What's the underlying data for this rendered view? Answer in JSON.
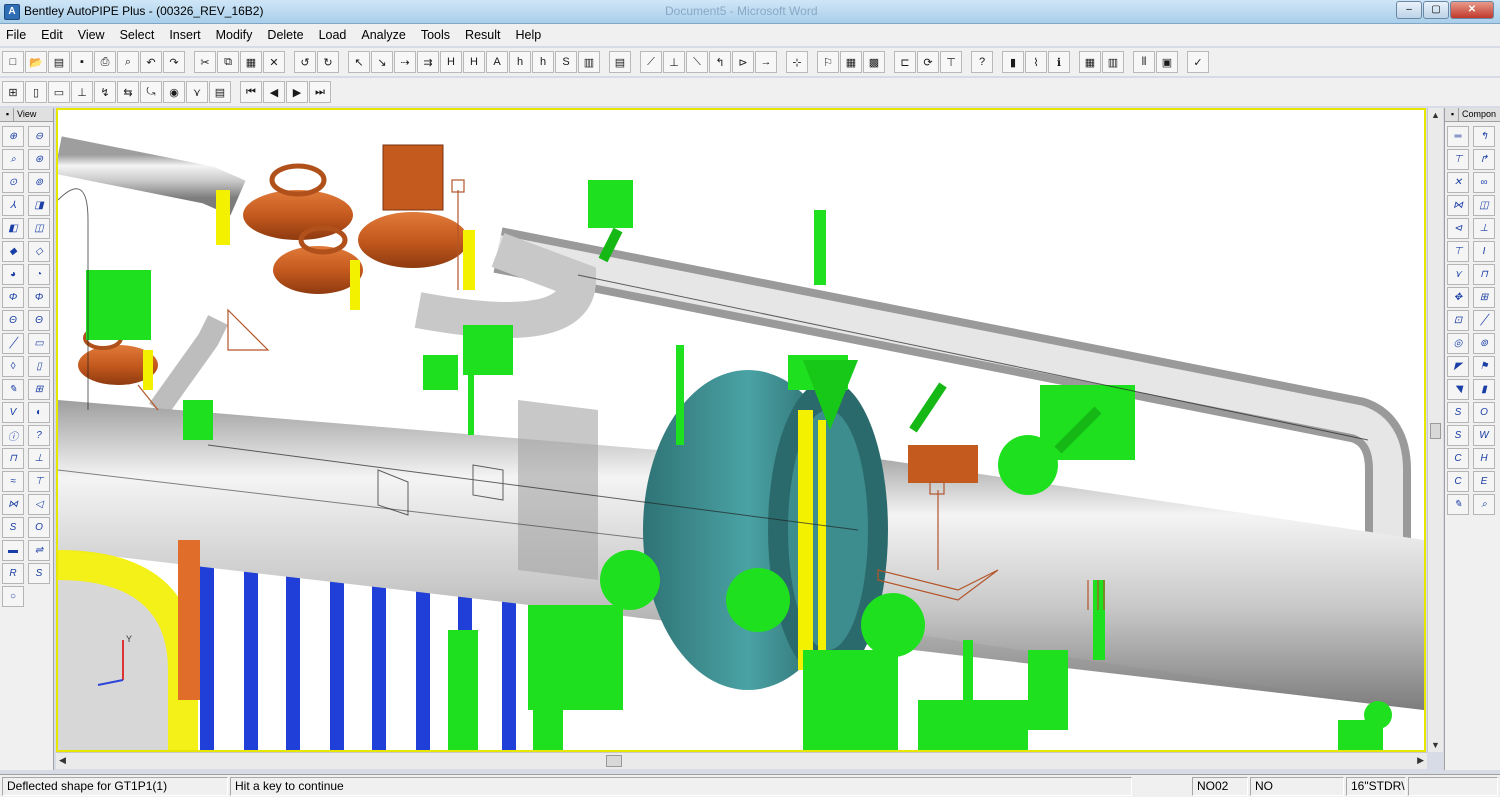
{
  "window": {
    "title": "Bentley AutoPIPE Plus - (00326_REV_16B2)",
    "background_title": "Document5 - Microsoft Word",
    "icon_letter": "A",
    "buttons": {
      "minimize": "–",
      "maximize": "▢",
      "close": "✕"
    }
  },
  "menu": [
    "File",
    "Edit",
    "View",
    "Select",
    "Insert",
    "Modify",
    "Delete",
    "Load",
    "Analyze",
    "Tools",
    "Result",
    "Help"
  ],
  "toolbar_row1": [
    {
      "icon": "new-icon",
      "glyph": "□"
    },
    {
      "icon": "open-icon",
      "glyph": "📂"
    },
    {
      "icon": "open-model-icon",
      "glyph": "▤"
    },
    {
      "icon": "save-icon",
      "glyph": "▪"
    },
    {
      "icon": "print-icon",
      "glyph": "⎙"
    },
    {
      "icon": "print-preview-icon",
      "glyph": "⌕"
    },
    {
      "icon": "undo-model-icon",
      "glyph": "↶"
    },
    {
      "icon": "redo-model-icon",
      "glyph": "↷"
    },
    {
      "sep": true
    },
    {
      "icon": "cut-icon",
      "glyph": "✂"
    },
    {
      "icon": "copy-icon",
      "glyph": "⧉"
    },
    {
      "icon": "paste-icon",
      "glyph": "▦"
    },
    {
      "icon": "delete-icon",
      "glyph": "✕"
    },
    {
      "sep": true
    },
    {
      "icon": "undo-icon",
      "glyph": "↺"
    },
    {
      "icon": "redo-icon",
      "glyph": "↻"
    },
    {
      "sep": true
    },
    {
      "icon": "select-point-icon",
      "glyph": "↖"
    },
    {
      "icon": "select-segment-icon",
      "glyph": "↘"
    },
    {
      "icon": "select-range-icon",
      "glyph": "⇢"
    },
    {
      "icon": "select-all-icon",
      "glyph": "⇉"
    },
    {
      "icon": "hide-icon",
      "glyph": "H"
    },
    {
      "icon": "hide-segment-icon",
      "glyph": "H"
    },
    {
      "icon": "show-all-icon",
      "glyph": "A"
    },
    {
      "icon": "hide-support-icon",
      "glyph": "h"
    },
    {
      "icon": "hide-node-icon",
      "glyph": "h"
    },
    {
      "icon": "show-icon",
      "glyph": "S"
    },
    {
      "icon": "document-icon",
      "glyph": "▥"
    },
    {
      "sep": true
    },
    {
      "icon": "report-icon",
      "glyph": "▤"
    },
    {
      "sep": true
    },
    {
      "icon": "pipe-route-icon",
      "glyph": "⟋"
    },
    {
      "icon": "tee-icon",
      "glyph": "⊥"
    },
    {
      "icon": "connect-icon",
      "glyph": "⟍"
    },
    {
      "icon": "bend-icon",
      "glyph": "↰"
    },
    {
      "icon": "reducer-icon",
      "glyph": "⊳"
    },
    {
      "icon": "arrow-right-icon",
      "glyph": "→"
    },
    {
      "sep": true
    },
    {
      "icon": "cursor-icon",
      "glyph": "⊹"
    },
    {
      "sep": true
    },
    {
      "icon": "model-run-icon",
      "glyph": "⚐"
    },
    {
      "icon": "grid-icon",
      "glyph": "▦"
    },
    {
      "icon": "results-grid-icon",
      "glyph": "▩"
    },
    {
      "sep": true
    },
    {
      "icon": "node-offset-icon",
      "glyph": "⊏"
    },
    {
      "icon": "rotate-icon",
      "glyph": "⟳"
    },
    {
      "icon": "anchor-icon",
      "glyph": "⊤"
    },
    {
      "sep": true
    },
    {
      "icon": "help-icon",
      "glyph": "?"
    },
    {
      "sep": true
    },
    {
      "icon": "bar-chart-icon",
      "glyph": "▮"
    },
    {
      "icon": "graph-icon",
      "glyph": "⌇"
    },
    {
      "icon": "info-icon",
      "glyph": "ℹ"
    },
    {
      "sep": true
    },
    {
      "icon": "table-icon",
      "glyph": "▦"
    },
    {
      "icon": "table2-icon",
      "glyph": "▥"
    },
    {
      "sep": true
    },
    {
      "icon": "columns-icon",
      "glyph": "⫴"
    },
    {
      "icon": "calc-icon",
      "glyph": "▣"
    },
    {
      "sep": true
    },
    {
      "icon": "check-icon",
      "glyph": "✓"
    }
  ],
  "toolbar_row2": [
    {
      "icon": "view-tool-1-icon",
      "glyph": "⊞"
    },
    {
      "icon": "view-tool-2-icon",
      "glyph": "▯"
    },
    {
      "icon": "view-tool-3-icon",
      "glyph": "▭"
    },
    {
      "icon": "view-tool-4-icon",
      "glyph": "⊥"
    },
    {
      "icon": "view-tool-5-icon",
      "glyph": "↯"
    },
    {
      "icon": "view-tool-6-icon",
      "glyph": "⇆"
    },
    {
      "icon": "view-tool-7-icon",
      "glyph": "⤿"
    },
    {
      "icon": "view-tool-8-icon",
      "glyph": "◉"
    },
    {
      "icon": "view-tool-9-icon",
      "glyph": "⋎"
    },
    {
      "icon": "view-tool-10-icon",
      "glyph": "▤"
    },
    {
      "sep": true
    },
    {
      "icon": "first-icon",
      "glyph": "⏮"
    },
    {
      "icon": "previous-icon",
      "glyph": "◀"
    },
    {
      "icon": "next-icon",
      "glyph": "▶"
    },
    {
      "icon": "last-icon",
      "glyph": "⏭"
    }
  ],
  "left_panel": {
    "title": "View",
    "tools": [
      {
        "icon": "zoom-in-icon",
        "glyph": "⊕"
      },
      {
        "icon": "zoom-out-icon",
        "glyph": "⊖"
      },
      {
        "icon": "zoom-window-icon",
        "glyph": "⌕"
      },
      {
        "icon": "zoom-extents-icon",
        "glyph": "⊛"
      },
      {
        "icon": "zoom-previous-icon",
        "glyph": "⊙"
      },
      {
        "icon": "zoom-all-icon",
        "glyph": "⊚"
      },
      {
        "icon": "iso-view-icon",
        "glyph": "⅄"
      },
      {
        "icon": "3d-view-icon",
        "glyph": "◨"
      },
      {
        "icon": "front-view-icon",
        "glyph": "◧"
      },
      {
        "icon": "side-view-icon",
        "glyph": "◫"
      },
      {
        "icon": "shade-icon",
        "glyph": "◆"
      },
      {
        "icon": "wire-icon",
        "glyph": "◇"
      },
      {
        "icon": "render-icon",
        "glyph": "◕"
      },
      {
        "icon": "render-2-icon",
        "glyph": "◔"
      },
      {
        "icon": "rotate-x-icon",
        "glyph": "Φ"
      },
      {
        "icon": "rotate-y-icon",
        "glyph": "Φ"
      },
      {
        "icon": "rotate-z-icon",
        "glyph": "Θ"
      },
      {
        "icon": "rotate-w-icon",
        "glyph": "Θ"
      },
      {
        "icon": "line-icon",
        "glyph": "╱"
      },
      {
        "icon": "rect-icon",
        "glyph": "▭"
      },
      {
        "icon": "erase-icon",
        "glyph": "◊"
      },
      {
        "icon": "frame-icon",
        "glyph": "▯"
      },
      {
        "icon": "pencil-icon",
        "glyph": "✎"
      },
      {
        "icon": "grid-view-icon",
        "glyph": "⊞"
      },
      {
        "icon": "valve-icon",
        "glyph": "V"
      },
      {
        "icon": "flange-icon",
        "glyph": "◐"
      },
      {
        "icon": "info-node-icon",
        "glyph": "ⓘ"
      },
      {
        "icon": "query-icon",
        "glyph": "?"
      },
      {
        "icon": "support-icon",
        "glyph": "⊓"
      },
      {
        "icon": "hanger-icon",
        "glyph": "⊥"
      },
      {
        "icon": "spring-icon",
        "glyph": "≈"
      },
      {
        "icon": "restraint-icon",
        "glyph": "⊤"
      },
      {
        "icon": "joint-icon",
        "glyph": "⋈"
      },
      {
        "icon": "flex-icon",
        "glyph": "◁"
      },
      {
        "icon": "soil-icon",
        "glyph": "S"
      },
      {
        "icon": "soil-2-icon",
        "glyph": "O"
      },
      {
        "icon": "beam-icon",
        "glyph": "▬"
      },
      {
        "icon": "beam-2-icon",
        "glyph": "⇌"
      },
      {
        "icon": "ref-icon",
        "glyph": "R"
      },
      {
        "icon": "sif-icon",
        "glyph": "S"
      },
      {
        "icon": "circle-icon",
        "glyph": "○"
      }
    ]
  },
  "right_panel": {
    "title": "Compon",
    "tools": [
      {
        "icon": "pipe-icon",
        "glyph": "═"
      },
      {
        "icon": "bend-comp-icon",
        "glyph": "↰"
      },
      {
        "icon": "tee-comp-icon",
        "glyph": "⊤"
      },
      {
        "icon": "elbow-comp-icon",
        "glyph": "↱"
      },
      {
        "icon": "cross-comp-icon",
        "glyph": "✕"
      },
      {
        "icon": "loop-comp-icon",
        "glyph": "∞"
      },
      {
        "icon": "valve-comp-icon",
        "glyph": "⋈"
      },
      {
        "icon": "flange-comp-icon",
        "glyph": "◫"
      },
      {
        "icon": "reducer-comp-icon",
        "glyph": "⊲"
      },
      {
        "icon": "weld-comp-icon",
        "glyph": "⊥"
      },
      {
        "icon": "joint-comp-icon",
        "glyph": "⊤"
      },
      {
        "icon": "beam-comp-icon",
        "glyph": "Ι"
      },
      {
        "icon": "support-comp-icon",
        "glyph": "⋎"
      },
      {
        "icon": "guide-comp-icon",
        "glyph": "⊓"
      },
      {
        "icon": "move-comp-icon",
        "glyph": "✥"
      },
      {
        "icon": "anchor-comp-icon",
        "glyph": "⊞"
      },
      {
        "icon": "node-comp-icon",
        "glyph": "⊡"
      },
      {
        "icon": "line-comp-icon",
        "glyph": "╱"
      },
      {
        "icon": "target-comp-icon",
        "glyph": "◎"
      },
      {
        "icon": "ring-comp-icon",
        "glyph": "⊚"
      },
      {
        "icon": "force-comp-icon",
        "glyph": "◤"
      },
      {
        "icon": "moment-comp-icon",
        "glyph": "⚑"
      },
      {
        "icon": "tag-comp-icon",
        "glyph": "◥"
      },
      {
        "icon": "chart-comp-icon",
        "glyph": "▮"
      },
      {
        "icon": "seg-comp-icon",
        "glyph": "S"
      },
      {
        "icon": "soil-comp-icon",
        "glyph": "O"
      },
      {
        "icon": "sif-comp-icon",
        "glyph": "S"
      },
      {
        "icon": "weld2-comp-icon",
        "glyph": "W"
      },
      {
        "icon": "cut-comp-icon",
        "glyph": "C"
      },
      {
        "icon": "hyd-comp-icon",
        "glyph": "H"
      },
      {
        "icon": "co-comp-icon",
        "glyph": "C"
      },
      {
        "icon": "eq-comp-icon",
        "glyph": "E"
      },
      {
        "icon": "pen-comp-icon",
        "glyph": "✎"
      },
      {
        "icon": "search-comp-icon",
        "glyph": "⌕"
      }
    ]
  },
  "viewport": {
    "axis_labels": [
      "Y",
      "X",
      "Z"
    ]
  },
  "status": {
    "message": "Deflected shape for  GT1P1(1)",
    "hint": "Hit a key to continue",
    "node": "NO02",
    "flag": "NO",
    "pipe_id": "16\"STDR\\"
  },
  "colors": {
    "pipe": "#c8c8c8",
    "valve": "#c55a1e",
    "support": "#1fe01f",
    "column": "#1f3fd8",
    "nozzle": "#3a8c8e",
    "highlight": "#f3f000",
    "viewport_border": "#e6e600"
  }
}
